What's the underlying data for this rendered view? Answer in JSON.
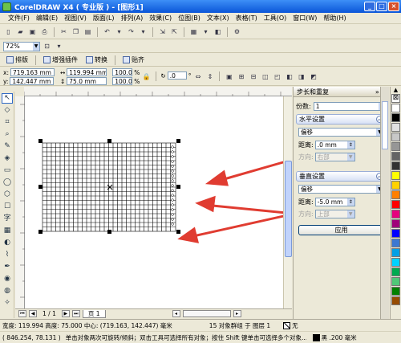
{
  "window": {
    "title": "CorelDRAW X4 ( 专业版 ) - [图形1]",
    "btn_min": "_",
    "btn_max": "□",
    "btn_close": "×"
  },
  "menu": [
    "文件(F)",
    "编辑(E)",
    "视图(V)",
    "版面(L)",
    "排列(A)",
    "效果(C)",
    "位图(B)",
    "文本(X)",
    "表格(T)",
    "工具(O)",
    "窗口(W)",
    "帮助(H)"
  ],
  "zoom": "72%",
  "plugins": {
    "typeset": "排版",
    "enhance": "增强插件",
    "convert": "转换",
    "paste": "贴齐"
  },
  "propbar": {
    "x_label": "x:",
    "x": "719.163 mm",
    "y_label": "y:",
    "y": "142.447 mm",
    "w": "119.994 mm",
    "h": "75.0 mm",
    "sx": "100.0",
    "sy": "100.0",
    "pct": "%",
    "angle": ".0",
    "deg": "°"
  },
  "pagenav": {
    "counter": "1 / 1",
    "page_tab": "页 1"
  },
  "status": {
    "line1": "宽度: 119.994  高度: 75.000  中心: (719.163, 142.447)  毫米",
    "group": "15 对象群组 于 图层 1",
    "line2": "( 846.254, 78.131 )",
    "hint": "单击对象两次可旋转/倾斜；双击工具可选择所有对象；按住 Shift 键单击可选择多个对象...",
    "fill_label": "无",
    "outline_label": "黑 .200 毫米"
  },
  "docker": {
    "title": "步长和重复",
    "copies_label": "份数:",
    "copies": "1",
    "h_section": "水平设置",
    "h_mode": "偏移",
    "h_dist_label": "距离:",
    "h_dist": ".0 mm",
    "h_dir_label": "方向:",
    "h_dir": "右部",
    "v_section": "垂直设置",
    "v_mode": "偏移",
    "v_dist_label": "距离:",
    "v_dist": "-5.0 mm",
    "v_dir_label": "方向:",
    "v_dir": "上部",
    "apply": "应用"
  },
  "colors": {
    "palette": [
      "#ffffff",
      "#000000",
      "#e1e1e1",
      "#c8c8c8",
      "#969696",
      "#646464",
      "#323232",
      "#ffff00",
      "#ffd200",
      "#ff7f00",
      "#ff0000",
      "#e6007e",
      "#a0007a",
      "#0000ff",
      "#3c78d2",
      "#00a0e6",
      "#00d2ff",
      "#00aa50",
      "#50c878",
      "#008000",
      "#964b00",
      "#c89632",
      "#6e3cb4",
      "#ff99cc"
    ],
    "arrow": "#e03c31"
  }
}
